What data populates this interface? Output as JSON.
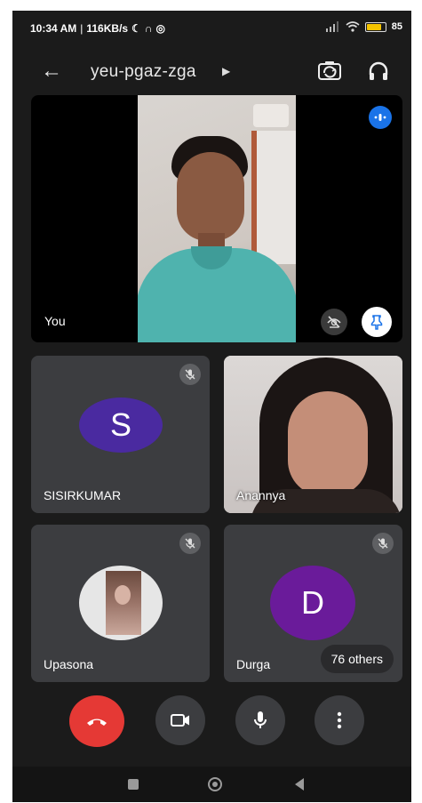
{
  "status_bar": {
    "time": "10:34 AM",
    "network_speed": "116KB/s",
    "battery_percent": 85,
    "battery_label": "85"
  },
  "meeting": {
    "code": "yeu-pgaz-zga"
  },
  "self_tile": {
    "label": "You"
  },
  "participants": [
    {
      "name": "SISIRKUMAR",
      "initial": "S",
      "color": "#4a2aa0",
      "muted": true
    },
    {
      "name": "Anannya",
      "muted": false
    },
    {
      "name": "Upasona",
      "muted": true
    },
    {
      "name": "Durga",
      "initial": "D",
      "color": "#6a1b9a",
      "muted": true
    }
  ],
  "others": {
    "label": "76 others"
  },
  "colors": {
    "end_call": "#e53935",
    "control_bg": "#3c3d40",
    "accent_blue": "#1a73e8",
    "pin_blue": "#8ab4f8",
    "background": "#1b1b1b"
  },
  "icons": {
    "back": "arrow-left",
    "switch_camera": "camera-switch",
    "audio_output": "headphones",
    "active_speaker": "audio-level",
    "effects": "eye-off",
    "pin": "pin",
    "muted": "mic-off",
    "end_call": "phone-hangup",
    "video": "video-camera",
    "mic": "microphone",
    "more": "more-vertical"
  }
}
